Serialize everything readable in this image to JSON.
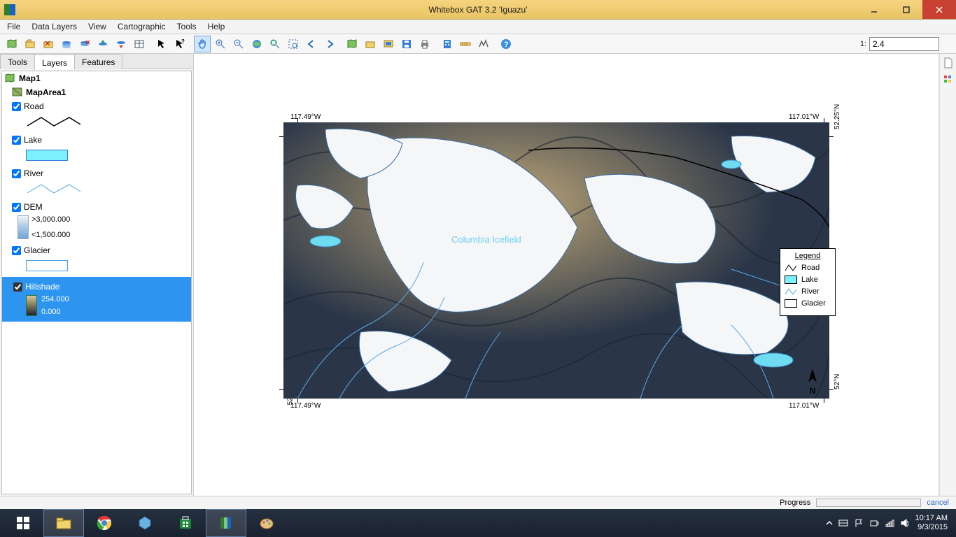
{
  "window": {
    "title": "Whitebox GAT 3.2 'Iguazu'"
  },
  "menubar": [
    "File",
    "Data Layers",
    "View",
    "Cartographic",
    "Tools",
    "Help"
  ],
  "toolbar": {
    "scale_prefix": "1:",
    "scale_value": "2.4"
  },
  "tabs": {
    "tools": "Tools",
    "layers": "Layers",
    "features": "Features"
  },
  "tree": {
    "map": "Map1",
    "area": "MapArea1",
    "road": {
      "label": "Road",
      "checked": true,
      "color": "#000000"
    },
    "lake": {
      "label": "Lake",
      "checked": true,
      "fill": "#7cf0ff",
      "stroke": "#2e7dd6"
    },
    "river": {
      "label": "River",
      "checked": true,
      "color": "#58a8e8"
    },
    "dem": {
      "label": "DEM",
      "checked": true,
      "max": ">3,000.000",
      "min": "<1,500.000"
    },
    "glacier": {
      "label": "Glacier",
      "checked": true,
      "stroke": "#49a0e8",
      "fill": "#ffffff"
    },
    "hillshade": {
      "label": "Hillshade",
      "checked": true,
      "max": "254.000",
      "min": "0.000"
    }
  },
  "map": {
    "feature_label": "Columbia Icefield",
    "coords": {
      "lon_left": "117.49°W",
      "lon_right": "117.01°W",
      "lat_top": "52.25°N",
      "lat_bottom": "52°N"
    },
    "legend": {
      "title": "Legend",
      "items": [
        {
          "label": "Road",
          "type": "line",
          "color": "#000000"
        },
        {
          "label": "Lake",
          "type": "fill",
          "fill": "#7cf0ff",
          "stroke": "#000000"
        },
        {
          "label": "River",
          "type": "line",
          "color": "#58a8e8"
        },
        {
          "label": "Glacier",
          "type": "fill",
          "fill": "#ffffff",
          "stroke": "#000000"
        }
      ]
    },
    "north_label": "N"
  },
  "statusbar": {
    "progress_label": "Progress",
    "cancel": "cancel"
  },
  "taskbar": {
    "time": "10:17 AM",
    "date": "9/3/2015"
  }
}
